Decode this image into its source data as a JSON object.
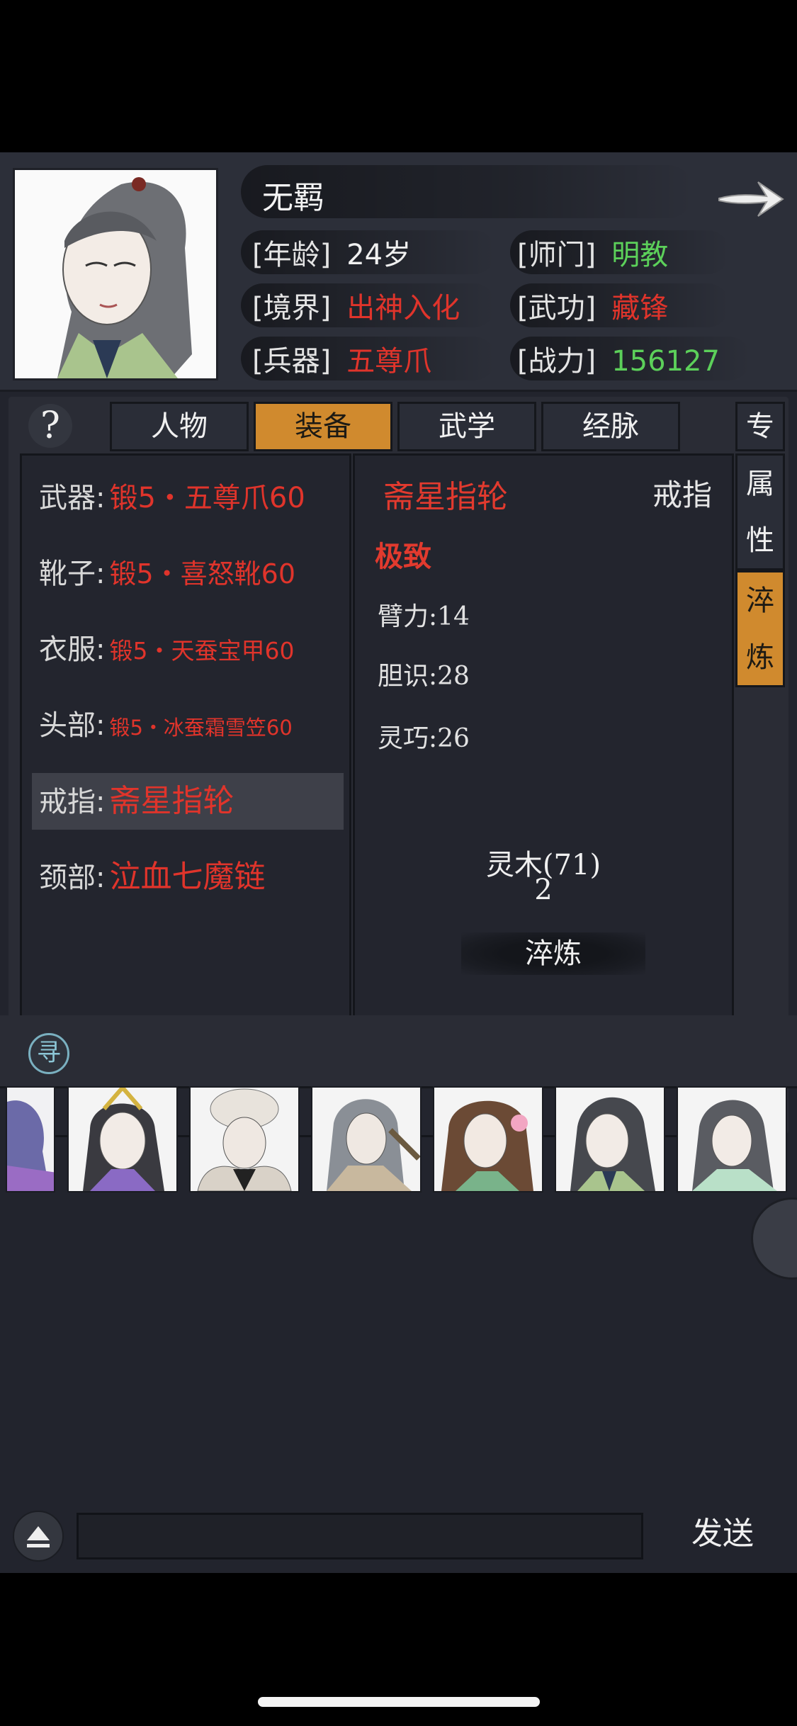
{
  "character": {
    "name": "无羁",
    "age_label": "[年龄]",
    "age_value": "24岁",
    "sect_label": "[师门]",
    "sect_value": "明教",
    "realm_label": "[境界]",
    "realm_value": "出神入化",
    "skill_label": "[武功]",
    "skill_value": "藏锋",
    "weapon_label": "[兵器]",
    "weapon_value": "五尊爪",
    "power_label": "[战力]",
    "power_value": "156127"
  },
  "help_label": "?",
  "tabs": [
    {
      "label": "人物"
    },
    {
      "label": "装备"
    },
    {
      "label": "武学"
    },
    {
      "label": "经脉"
    }
  ],
  "side_tabs": {
    "special": "专",
    "attr_1": "属",
    "attr_2": "性",
    "temper_1": "淬",
    "temper_2": "炼"
  },
  "equipment": [
    {
      "slot": "武器:",
      "item": "锻5・五尊爪60"
    },
    {
      "slot": "靴子:",
      "item": "锻5・喜怒靴60"
    },
    {
      "slot": "衣服:",
      "item": "锻5・天蚕宝甲60"
    },
    {
      "slot": "头部:",
      "item": "锻5・冰蚕霜雪笠60"
    },
    {
      "slot": "戒指:",
      "item": "斋星指轮"
    },
    {
      "slot": "颈部:",
      "item": "泣血七魔链"
    }
  ],
  "detail": {
    "name": "斋星指轮",
    "type": "戒指",
    "grade": "极致",
    "stats": [
      "臂力:14",
      "胆识:28",
      "灵巧:26"
    ],
    "material": "灵木(71)",
    "material_count": "2",
    "temper_button": "淬炼"
  },
  "seek_icon_label": "寻",
  "chat": {
    "input_placeholder": "",
    "send_label": "发送"
  },
  "colors": {
    "accent": "#d08a2e",
    "red": "#e0342b",
    "green": "#5cd05a",
    "background": "#22242d"
  }
}
